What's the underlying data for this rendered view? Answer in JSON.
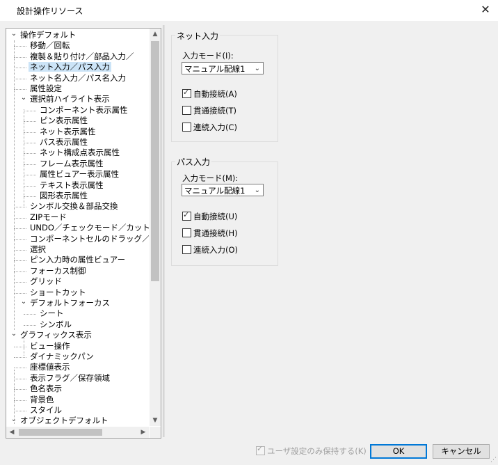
{
  "window": {
    "title": "設計操作リソース",
    "close_glyph": "✕"
  },
  "tree": [
    {
      "label": "操作デフォルト",
      "expander": "⌄",
      "level": 0
    },
    {
      "label": "移動／回転",
      "level": 1
    },
    {
      "label": "複製＆貼り付け／部品入力／",
      "level": 1
    },
    {
      "label": "ネット入力／パス入力",
      "level": 1,
      "selected": true
    },
    {
      "label": "ネット名入力／パス名入力",
      "level": 1
    },
    {
      "label": "属性設定",
      "level": 1
    },
    {
      "label": "選択前ハイライト表示",
      "expander": "⌄",
      "level": 1
    },
    {
      "label": "コンポーネント表示属性",
      "level": 2
    },
    {
      "label": "ピン表示属性",
      "level": 2
    },
    {
      "label": "ネット表示属性",
      "level": 2
    },
    {
      "label": "パス表示属性",
      "level": 2
    },
    {
      "label": "ネット構成点表示属性",
      "level": 2
    },
    {
      "label": "フレーム表示属性",
      "level": 2
    },
    {
      "label": "属性ビュアー表示属性",
      "level": 2
    },
    {
      "label": "テキスト表示属性",
      "level": 2
    },
    {
      "label": "図形表示属性",
      "level": 2
    },
    {
      "label": "シンボル交換＆部品交換",
      "level": 1
    },
    {
      "label": "ZIPモード",
      "level": 1
    },
    {
      "label": "UNDO／チェックモード／カットバ",
      "level": 1
    },
    {
      "label": "コンポーネントセルのドラッグ／スト",
      "level": 1
    },
    {
      "label": "選択",
      "level": 1
    },
    {
      "label": "ピン入力時の属性ビュアー",
      "level": 1
    },
    {
      "label": "フォーカス制御",
      "level": 1
    },
    {
      "label": "グリッド",
      "level": 1
    },
    {
      "label": "ショートカット",
      "level": 1
    },
    {
      "label": "デフォルトフォーカス",
      "expander": "⌄",
      "level": 1
    },
    {
      "label": "シート",
      "level": 2
    },
    {
      "label": "シンボル",
      "level": 2
    },
    {
      "label": "グラフィックス表示",
      "expander": "⌄",
      "level": 0
    },
    {
      "label": "ビュー操作",
      "level": 1
    },
    {
      "label": "ダイナミックパン",
      "level": 1
    },
    {
      "label": "座標値表示",
      "level": 1
    },
    {
      "label": "表示フラグ／保存領域",
      "level": 1
    },
    {
      "label": "色名表示",
      "level": 1
    },
    {
      "label": "背景色",
      "level": 1
    },
    {
      "label": "スタイル",
      "level": 1
    },
    {
      "label": "オブジェクトデフォルト",
      "expander": "⌄",
      "level": 0
    }
  ],
  "net_group": {
    "title": "ネット入力",
    "mode_label": "入力モード(I):",
    "mode_value": "マニュアル配線1",
    "checks": [
      {
        "label": "自動接続(A)",
        "checked": true
      },
      {
        "label": "貫通接続(T)",
        "checked": false
      },
      {
        "label": "連続入力(C)",
        "checked": false
      }
    ]
  },
  "path_group": {
    "title": "パス入力",
    "mode_label": "入力モード(M):",
    "mode_value": "マニュアル配線1",
    "checks": [
      {
        "label": "自動接続(U)",
        "checked": true
      },
      {
        "label": "貫通接続(H)",
        "checked": false
      },
      {
        "label": "連続入力(O)",
        "checked": false
      }
    ]
  },
  "footer": {
    "keep_label": "ユーザ設定のみ保持する(K)",
    "keep_checked": true,
    "ok_label": "OK",
    "cancel_label": "キャンセル"
  }
}
